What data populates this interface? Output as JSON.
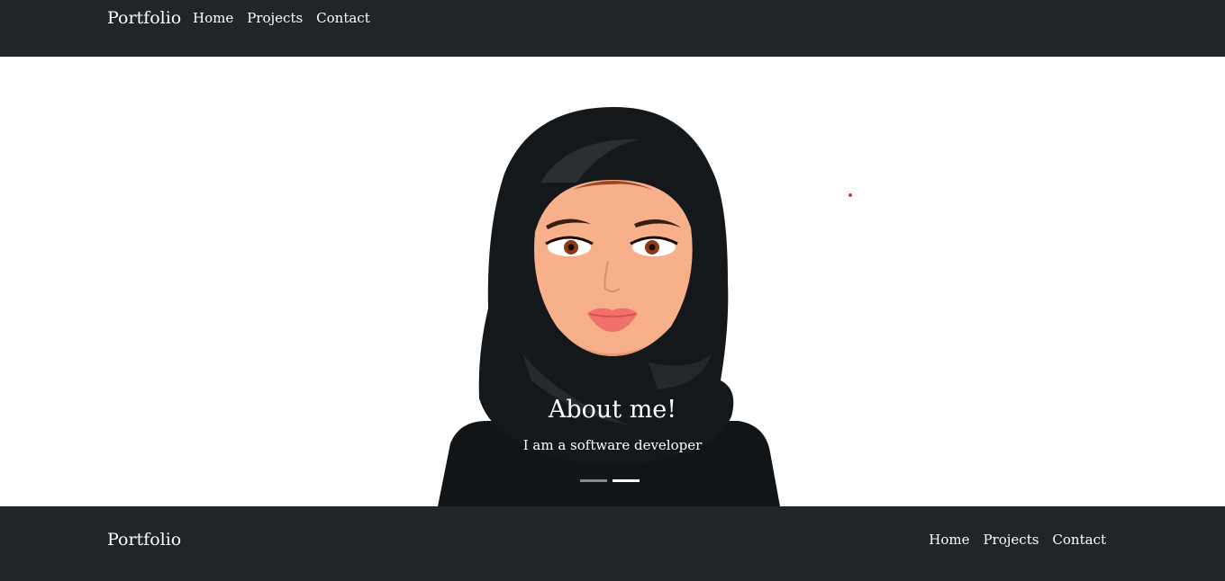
{
  "header": {
    "brand": "Portfolio",
    "nav": [
      "Home",
      "Projects",
      "Contact"
    ]
  },
  "hero": {
    "caption_title": "About me!",
    "caption_subtitle": "I am a software developer",
    "slide_indicators": {
      "count": 2,
      "active_index": 1
    }
  },
  "footer": {
    "brand": "Portfolio",
    "nav": [
      "Home",
      "Projects",
      "Contact"
    ]
  },
  "colors": {
    "navbar_bg": "#212529",
    "hero_bg": "#ffffff",
    "text_light": "#ffffff",
    "hijab": "#15181b",
    "skin": "#f7b08a",
    "lips": "#f0706a"
  }
}
